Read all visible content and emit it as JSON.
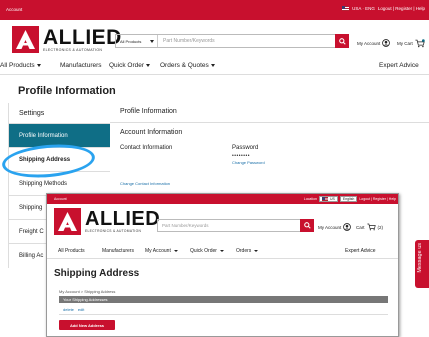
{
  "topbar": {
    "account": "Account",
    "locale": "USA · ENG",
    "links": "Logout | Register | Help"
  },
  "brand": {
    "name": "ALLIED",
    "tagline": "ELECTRONICS & AUTOMATION"
  },
  "search": {
    "category": "All Products",
    "placeholder": "Part Number/Keywords"
  },
  "header": {
    "my_account": "My Account",
    "my_cart": "My Cart",
    "cart_count": "0"
  },
  "nav": {
    "all_products": "All Products",
    "manufacturers": "Manufacturers",
    "quick_order": "Quick Order",
    "orders_quotes": "Orders & Quotes",
    "expert_advice": "Expert Advice"
  },
  "profile": {
    "title": "Profile Information",
    "settings": "Settings",
    "main_heading": "Profile Information",
    "account_info": "Account Information",
    "contact_info": "Contact Information",
    "password_label": "Password",
    "password_value": "••••••••",
    "change_password": "Change Password",
    "change_contact": "Change Contact Information"
  },
  "sidebar": {
    "items": [
      {
        "label": "Profile Information"
      },
      {
        "label": "Shipping Address"
      },
      {
        "label": "Shipping Methods"
      },
      {
        "label": "Shipping"
      },
      {
        "label": "Freight C"
      },
      {
        "label": "Billing Ac"
      }
    ]
  },
  "overlay": {
    "topbar": {
      "account": "Account",
      "location_label": "Location",
      "location_value": "US",
      "language_value": "English",
      "links": "Logout | Register | Help"
    },
    "search_placeholder": "Part Number/Keywords",
    "my_account": "My Account",
    "cart": "Cart",
    "cart_count": "(2)",
    "nav": {
      "all_products": "All Products",
      "manufacturers": "Manufacturers",
      "my_account": "My Account",
      "quick_order": "Quick Order",
      "orders": "Orders",
      "expert_advice": "Expert Advice"
    },
    "title": "Shipping Address",
    "breadcrumb": "My Account > Shipping Address",
    "section_bar": "Your Shipping Addresses",
    "link_delete": "delete",
    "link_edit": "edit",
    "add_button": "Add New Address"
  },
  "message_tab": "Message us",
  "colors": {
    "brand_red": "#c8102e",
    "active_teal": "#0f6e86",
    "annotation_blue": "#2aa3ef",
    "link_blue": "#1a6fa8"
  }
}
